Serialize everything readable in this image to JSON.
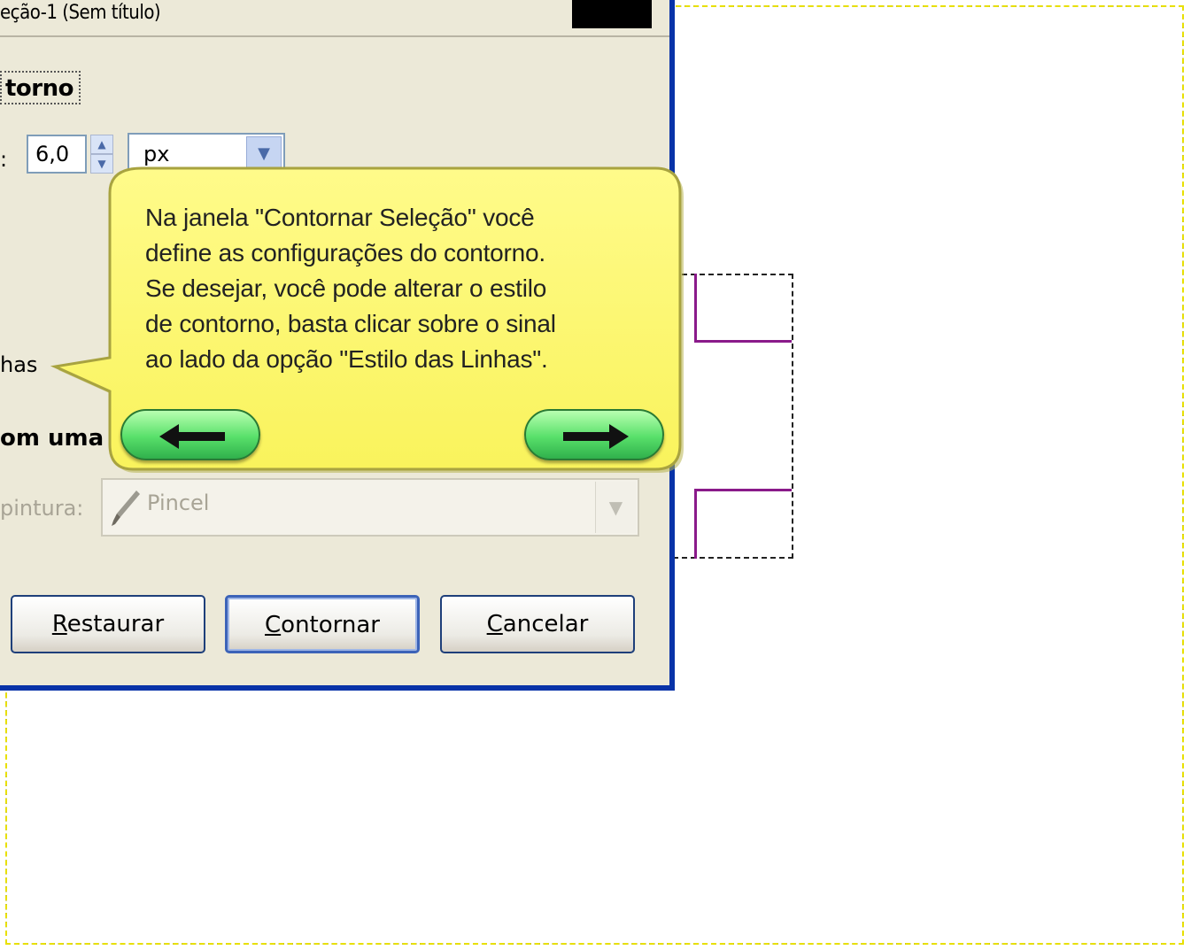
{
  "dialog": {
    "subtitle": "eção-1 (Sem título)",
    "section_title": "torno",
    "width_label": ":",
    "width_value": "6,0",
    "unit_value": "px",
    "line_style_label": "has",
    "radio_label": "om uma",
    "paint_tool_label": "pintura:",
    "paint_tool_value": "Pincel",
    "buttons": {
      "reset": {
        "mnemonic": "R",
        "rest": "estaurar"
      },
      "stroke": {
        "mnemonic": "C",
        "rest": "ontornar"
      },
      "cancel": {
        "mnemonic": "C",
        "rest": "ancelar"
      }
    }
  },
  "tooltip": {
    "lines": [
      "Na janela \"Contornar Seleção\" você",
      "define as configurações do contorno.",
      "Se desejar, você pode alterar o estilo",
      "de contorno, basta clicar sobre o sinal",
      "ao lado da opção \"Estilo das Linhas\"."
    ],
    "prev_icon": "left-arrow-icon",
    "next_icon": "right-arrow-icon"
  },
  "colors": {
    "dialog_bg": "#ece9d8",
    "window_frame": "#0833a8",
    "tooltip_bg": "#fefa7a",
    "nav_button": "#58e06a",
    "selection_stroke": "#8a1a8a"
  }
}
